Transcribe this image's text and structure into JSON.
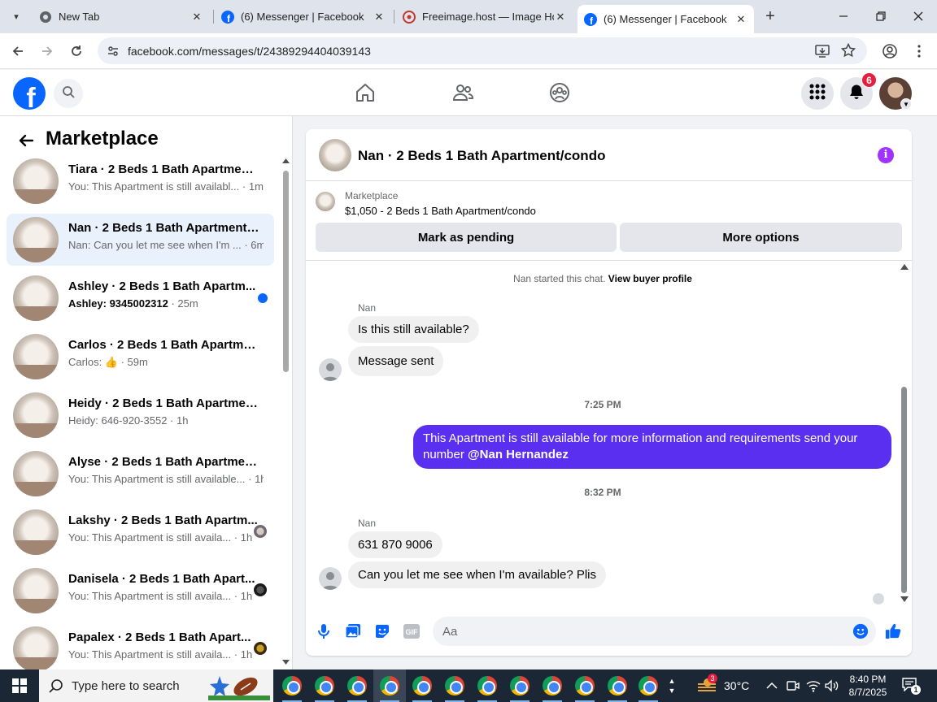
{
  "browser": {
    "tabs": [
      {
        "title": "New Tab",
        "favicon": "chrome-icon",
        "active": false
      },
      {
        "title": "(6) Messenger | Facebook",
        "favicon": "facebook-icon",
        "active": false
      },
      {
        "title": "Freeimage.host — Image Ho",
        "favicon": "freeimage-icon",
        "active": false
      },
      {
        "title": "(6) Messenger | Facebook",
        "favicon": "facebook-icon",
        "active": true
      }
    ],
    "url": "facebook.com/messages/t/24389294404039143"
  },
  "fb_header": {
    "notification_count": "6"
  },
  "sidebar": {
    "title": "Marketplace",
    "conversations": [
      {
        "name": "Tiara · 2 Beds 1 Bath Apartment/...",
        "snippet": "You: This Apartment is still availabl...",
        "time": " · 1m",
        "unread": false,
        "selected": false,
        "indicator": "none"
      },
      {
        "name": "Nan · 2 Beds 1 Bath Apartment/...",
        "snippet": "Nan: Can you let me see when I'm ...",
        "time": " · 6m",
        "unread": false,
        "selected": true,
        "indicator": "none"
      },
      {
        "name": "Ashley · 2 Beds 1 Bath Apartm...",
        "snippet": "Ashley: 9345002312",
        "time": " · 25m",
        "unread": true,
        "selected": false,
        "indicator": "unread-dot"
      },
      {
        "name": "Carlos · 2 Beds 1 Bath Apartmen...",
        "snippet": "Carlos: 👍",
        "time": " · 59m",
        "unread": false,
        "selected": false,
        "indicator": "none"
      },
      {
        "name": "Heidy · 2 Beds 1 Bath Apartment...",
        "snippet": "Heidy: 646-920-3552",
        "time": " · 1h",
        "unread": false,
        "selected": false,
        "indicator": "none"
      },
      {
        "name": "Alyse · 2 Beds 1 Bath Apartment...",
        "snippet": "You: This Apartment is still available...",
        "time": " · 1h",
        "unread": false,
        "selected": false,
        "indicator": "none"
      },
      {
        "name": "Lakshy · 2 Beds 1 Bath Apartm...",
        "snippet": "You: This Apartment is still availa...",
        "time": " · 1h",
        "unread": false,
        "selected": false,
        "indicator": "seen-avatar"
      },
      {
        "name": "Danisela · 2 Beds 1 Bath Apart...",
        "snippet": "You: This Apartment is still availa...",
        "time": " · 1h",
        "unread": false,
        "selected": false,
        "indicator": "seen-avatar"
      },
      {
        "name": "Papalex · 2 Beds 1 Bath Apart...",
        "snippet": "You: This Apartment is still availa...",
        "time": " · 1h",
        "unread": false,
        "selected": false,
        "indicator": "seen-avatar"
      }
    ]
  },
  "chat": {
    "title": "Nan · 2 Beds 1 Bath Apartment/condo",
    "marketplace_label": "Marketplace",
    "listing": "$1,050 - 2 Beds 1 Bath Apartment/condo",
    "mark_pending_label": "Mark as pending",
    "more_options_label": "More options",
    "started_text": "Nan started this chat.",
    "view_profile_label": "View buyer profile",
    "sender_1": "Nan",
    "msg_1": "Is this still available?",
    "msg_2": "Message sent",
    "time_1": "7:25 PM",
    "mine_msg": "This Apartment is still available for more information and requirements send your number",
    "mine_mention": "@Nan Hernandez",
    "time_2": "8:32 PM",
    "sender_2": "Nan",
    "msg_3": "631 870 9006",
    "msg_4": "Can you let me see when I'm available? Plis",
    "composer_placeholder": "Aa"
  },
  "taskbar": {
    "search_placeholder": "Type here to search",
    "temperature": "30°C",
    "weather_badge": "3",
    "time": "8:40 PM",
    "date": "8/7/2025",
    "notification_count": "1"
  },
  "colors": {
    "fb_blue": "#0866ff",
    "my_bubble": "#5b2ff0",
    "selected_conv": "#e9f1fd"
  }
}
